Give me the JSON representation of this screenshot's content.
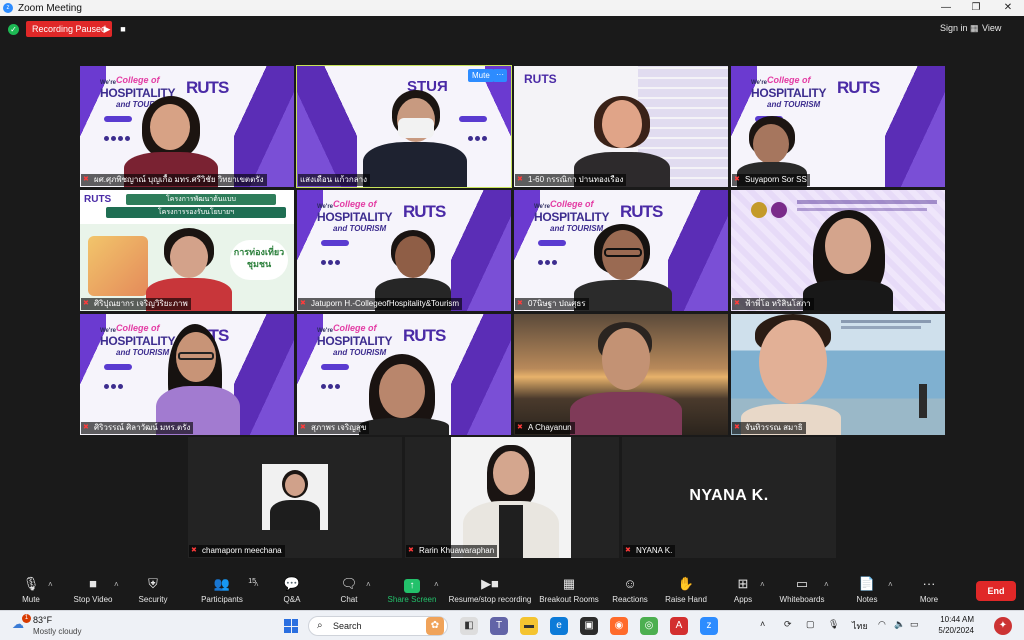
{
  "window": {
    "title": "Zoom Meeting",
    "controls": [
      "—",
      "❐",
      "✕"
    ]
  },
  "topbar": {
    "recording_status": "Recording Paused",
    "sign_in": "Sign in",
    "view": "View"
  },
  "tile_controls": {
    "mute": "Mute",
    "more": "···"
  },
  "participants": [
    {
      "name": "ผศ.ศุภพิชญาณ์ บุญเกื้อ มทร.ศรีวิชัย วิทยาเขตตรัง",
      "muted": true
    },
    {
      "name": "แสงเดือน แก้วกลาง",
      "muted": false,
      "active": true
    },
    {
      "name": "1-60 กรรณิกา ปานทองเรือง",
      "muted": true
    },
    {
      "name": "Suyaporn Sor SS",
      "muted": true
    },
    {
      "name": "ศิริปุณยากร เจริญวิริยะภาพ",
      "muted": true
    },
    {
      "name": "Jatuporn H.-CollegeofHospitality&Tourism",
      "muted": true
    },
    {
      "name": "07นิษฐา ปณศุธร",
      "muted": true
    },
    {
      "name": "ฟ้าพี่โอ หริสินโสภา",
      "muted": true
    },
    {
      "name": "ศิริวรรณ์ ศิลาวัฒน์ มทร.ตรัง",
      "muted": true
    },
    {
      "name": "สุภาพร เจริญสุข",
      "muted": true
    },
    {
      "name": "A Chayanun",
      "muted": true
    },
    {
      "name": "จันทิวรรณ สมาธิ",
      "muted": true
    },
    {
      "name": "chamaporn meechana",
      "muted": true
    },
    {
      "name": "Rarin Khuawaraphan",
      "muted": true
    },
    {
      "name": "NYANA K.",
      "muted": true,
      "initials": "NYANA K."
    }
  ],
  "backgrounds": {
    "branded": {
      "were": "We're",
      "college": "College of",
      "hospitality": "HOSPITALITY",
      "tourism": "and TOURISM",
      "logo": "RUTS",
      "badge": "Tourism"
    },
    "slide": {
      "line1": "โครงการพัฒนาต้นแบบ",
      "line2": "โครงการรองรับนโยบายฯ",
      "cta": "การท่องเที่ยวชุมชน"
    }
  },
  "toolbar": {
    "items": [
      {
        "label": "Mute",
        "icon": "microphone-icon"
      },
      {
        "label": "Stop Video",
        "icon": "video-camera-icon"
      },
      {
        "label": "Security",
        "icon": "shield-icon"
      },
      {
        "label": "Participants",
        "icon": "participants-icon",
        "count": "15"
      },
      {
        "label": "Q&A",
        "icon": "qa-icon"
      },
      {
        "label": "Chat",
        "icon": "chat-icon"
      },
      {
        "label": "Share Screen",
        "icon": "share-screen-icon"
      },
      {
        "label": "Resume/stop recording",
        "icon": "recording-icon"
      },
      {
        "label": "Breakout Rooms",
        "icon": "breakout-rooms-icon"
      },
      {
        "label": "Reactions",
        "icon": "reactions-icon"
      },
      {
        "label": "Raise Hand",
        "icon": "raise-hand-icon"
      },
      {
        "label": "Apps",
        "icon": "apps-icon"
      },
      {
        "label": "Whiteboards",
        "icon": "whiteboard-icon"
      },
      {
        "label": "Notes",
        "icon": "notes-icon"
      },
      {
        "label": "More",
        "icon": "more-icon"
      }
    ],
    "end": "End",
    "accent_green": "#23c16b",
    "end_color": "#e02828"
  },
  "taskbar": {
    "weather_temp": "83°F",
    "weather_cond": "Mostly cloudy",
    "weather_alert": "1",
    "search": "Search",
    "language": "ไทย",
    "time": "10:44 AM",
    "date": "5/20/2024"
  }
}
